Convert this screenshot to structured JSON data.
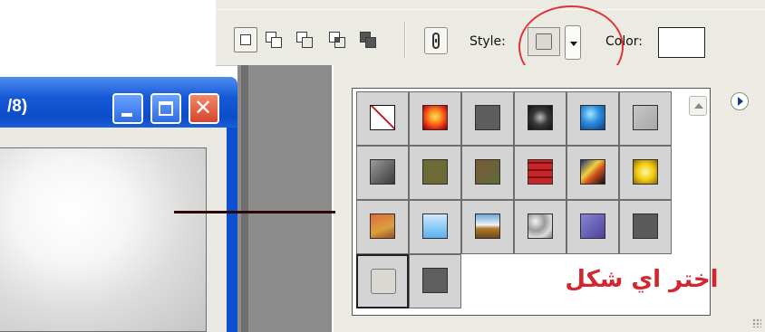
{
  "toolbar": {
    "style_label": "Style:",
    "color_label": "Color:",
    "color_value": "#ffffff"
  },
  "window": {
    "title": "/8)",
    "title_gradient": "#1659d8",
    "close_glyph": "✕"
  },
  "style_panel": {
    "annotation": "اختر اي شكل",
    "selected_index": 18,
    "styles": [
      {
        "name": "default-no-style",
        "swatch": "none"
      },
      {
        "name": "red-glow",
        "swatch": "radial-gradient(circle at 50% 45%, #ffe060 0%, #ff8a20 35%, #d81c10 75%, #700000 100%)"
      },
      {
        "name": "dark-gray-inset",
        "swatch": "#5d5d5d"
      },
      {
        "name": "black-chrome",
        "swatch": "radial-gradient(circle, #bdbdbd 0%, #3a3a3a 45%, #101010 100%)"
      },
      {
        "name": "blue-glass",
        "swatch": "radial-gradient(circle at 40% 35%, #9fe6ff 0%, #2b8bde 45%, #0b3d8c 100%)"
      },
      {
        "name": "gray-faded",
        "swatch": "linear-gradient(135deg, #c6c6c6, #a8a8a8)"
      },
      {
        "name": "gray-stone",
        "swatch": "linear-gradient(135deg, #9a9a9a, #3a3a3a)"
      },
      {
        "name": "olive-texture",
        "swatch": "#6d6a34"
      },
      {
        "name": "brown-olive",
        "swatch": "linear-gradient(135deg, #7a5a3a, #5e6a3a)"
      },
      {
        "name": "red-brick",
        "swatch": "repeating-linear-gradient(0deg, #c8262a 0px, #c8262a 6px, #7a1010 6px, #7a1010 8px)"
      },
      {
        "name": "abstract-blue-yellow",
        "swatch": "linear-gradient(135deg, #1a2a6a 0%, #f0d040 40%, #d05020 60%, #101010 100%)"
      },
      {
        "name": "yellow-gold",
        "swatch": "radial-gradient(circle, #fff6a0 0%, #f2cc10 50%, #8a6a00 100%)"
      },
      {
        "name": "orange-wood",
        "swatch": "linear-gradient(160deg, #e06a3a, #d8a23c 60%, #9a4a2a)"
      },
      {
        "name": "light-blue-glass",
        "swatch": "linear-gradient(180deg, #cfeaff, #5ab0f0)"
      },
      {
        "name": "landscape",
        "swatch": "linear-gradient(180deg, #6aa8e0 0%, #f2f2f2 45%, #b07a2a 60%, #6a4a1a 100%)"
      },
      {
        "name": "marble-pattern",
        "swatch": "radial-gradient(circle at 30% 30%, #f4f4f4 0%, #9a9a9a 40%, #dcdcdc 70%, #7a7a7a 100%)"
      },
      {
        "name": "purple-shadow",
        "swatch": "linear-gradient(135deg, #8a84d6, #4a4296)"
      },
      {
        "name": "dark-gray-flat",
        "swatch": "#5a5a5a"
      },
      {
        "name": "empty-selected",
        "swatch": "#d9d8d3"
      },
      {
        "name": "dark-gray-small",
        "swatch": "#5e5e5e"
      }
    ]
  }
}
